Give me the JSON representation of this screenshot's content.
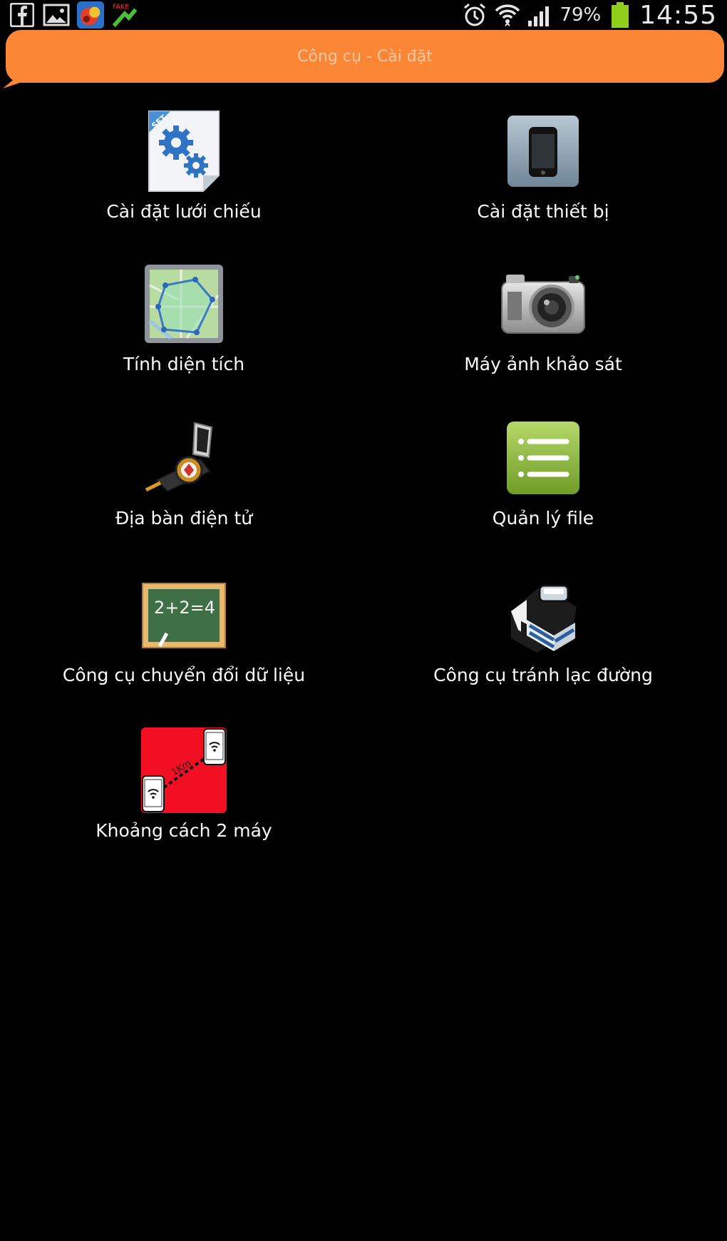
{
  "status_bar": {
    "left_icons": [
      "facebook-icon",
      "gallery-icon",
      "app-icon",
      "fake-gps-icon"
    ],
    "battery_percent": "79%",
    "time": "14:55"
  },
  "header": {
    "title": "Công cụ - Cài đặt",
    "color": "#fb8636"
  },
  "menu": {
    "items": [
      {
        "label": "Cài đặt lưới chiếu",
        "icon": "settings-gear-document-icon"
      },
      {
        "label": "Cài đặt thiết bị",
        "icon": "phone-device-icon"
      },
      {
        "label": "Tính diện tích",
        "icon": "map-area-icon"
      },
      {
        "label": "Máy ảnh khảo sát",
        "icon": "camera-icon"
      },
      {
        "label": "Địa bàn điện tử",
        "icon": "compass-icon"
      },
      {
        "label": "Quản lý file",
        "icon": "file-list-icon"
      },
      {
        "label": "Công cụ chuyển đổi dữ liệu",
        "icon": "chalkboard-icon"
      },
      {
        "label": "Công cụ tránh lạc đường",
        "icon": "home-icon"
      },
      {
        "label": "Khoảng cách 2 máy",
        "icon": "distance-two-phones-icon"
      }
    ],
    "distance_icon_text": "1Km",
    "set_badge_text": "SET",
    "chalkboard_text": "2+2=4"
  }
}
